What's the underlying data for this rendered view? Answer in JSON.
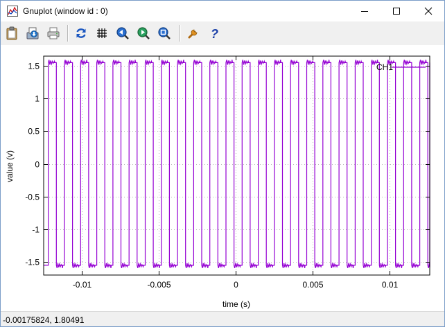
{
  "window": {
    "title": "Gnuplot (window id : 0)",
    "controls": [
      "minimize",
      "maximize",
      "close"
    ]
  },
  "toolbar": {
    "buttons": [
      {
        "name": "copy-to-clipboard",
        "icon": "clipboard-icon"
      },
      {
        "name": "save-image",
        "icon": "save-icon"
      },
      {
        "name": "print",
        "icon": "printer-icon"
      },
      {
        "name": "replot",
        "icon": "refresh-icon"
      },
      {
        "name": "toggle-grid",
        "icon": "grid-icon"
      },
      {
        "name": "previous-zoom",
        "icon": "zoom-previous-icon"
      },
      {
        "name": "next-zoom",
        "icon": "zoom-next-icon"
      },
      {
        "name": "autoscale",
        "icon": "zoom-autoscale-icon"
      },
      {
        "name": "options",
        "icon": "wrench-icon"
      },
      {
        "name": "help",
        "icon": "help-icon"
      }
    ]
  },
  "status": {
    "coordinates": "-0.00175824,  1.80491"
  },
  "colors": {
    "series": "#9400d3",
    "grid": "#a0a0a0",
    "frame": "#000000"
  },
  "chart_data": {
    "type": "line",
    "xlabel": "time  (s)",
    "ylabel": "value  (v)",
    "xlim": [
      -0.0125,
      0.0126
    ],
    "ylim": [
      -1.7,
      1.65
    ],
    "xticks": [
      -0.01,
      -0.005,
      0,
      0.005,
      0.01
    ],
    "xtick_labels": [
      "-0.01",
      "-0.005",
      "0",
      "0.005",
      "0.01"
    ],
    "yticks": [
      -1.5,
      -1,
      -0.5,
      0,
      0.5,
      1,
      1.5
    ],
    "ytick_labels": [
      "-1.5",
      "-1",
      "-0.5",
      "0",
      "0.5",
      "1",
      "1.5"
    ],
    "grid": true,
    "legend_position": "top-right",
    "series": [
      {
        "name": "CH1",
        "waveform": "square",
        "high": 1.55,
        "low": -1.55,
        "period": 0.00105,
        "first_rising_edge": -0.0122,
        "duty_cycle": 0.5
      }
    ]
  }
}
